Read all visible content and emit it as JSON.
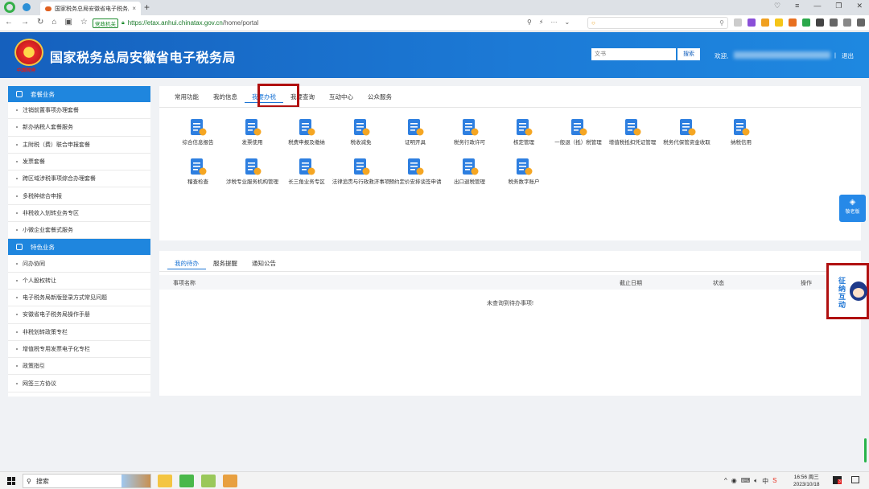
{
  "browser": {
    "tab_title": "国家税务总局安徽省电子税务局",
    "gov_badge": "党政机关",
    "url_host": "https://etax.anhui.chinatax.gov.cn",
    "url_path": "/home/portal",
    "new_tab": "+",
    "tab_close": "×"
  },
  "header": {
    "title": "国家税务总局安徽省电子税务局",
    "slogan": "中国税务",
    "search_placeholder": "文书",
    "search_button": "搜索",
    "welcome": "欢迎,",
    "separator": "|",
    "logout": "退出"
  },
  "sidebar": {
    "section1": "套餐业务",
    "items1": [
      "注销前置事项办理套餐",
      "新办纳税人套餐服务",
      "主附税（费）联合申报套餐",
      "发票套餐",
      "跨区域涉税事项综合办理套餐",
      "多税种综合申报",
      "非税收入划转业务专区",
      "小微企业套餐式服务"
    ],
    "section2": "特色业务",
    "items2": [
      "问办协同",
      "个人股权转让",
      "电子税务局新版登录方式常见问题",
      "安徽省电子税务局操作手册",
      "非税划转政策专栏",
      "增值税专用发票电子化专栏",
      "政策指引",
      "网签三方协议"
    ]
  },
  "main": {
    "tabs": [
      "常用功能",
      "我的信息",
      "我要办税",
      "我要查询",
      "互动中心",
      "公众服务"
    ],
    "active_tab": "我要办税",
    "tools": [
      {
        "label": "综合信息报告",
        "color": "#2e7fe0"
      },
      {
        "label": "发票使用",
        "color": "#2e7fe0"
      },
      {
        "label": "税费申报及缴纳",
        "color": "#2e7fe0"
      },
      {
        "label": "税收减免",
        "color": "#2e7fe0"
      },
      {
        "label": "证明开具",
        "color": "#2e7fe0"
      },
      {
        "label": "税务行政许可",
        "color": "#2e7fe0"
      },
      {
        "label": "核定管理",
        "color": "#2e7fe0"
      },
      {
        "label": "一般退（抵）税管理",
        "color": "#2e7fe0"
      },
      {
        "label": "增值税抵扣凭证管理",
        "color": "#2e7fe0"
      },
      {
        "label": "税务代保管资金收取",
        "color": "#2e7fe0"
      },
      {
        "label": "纳税信用",
        "color": "#2e7fe0"
      },
      {
        "label": "稽查检查",
        "color": "#2e7fe0"
      },
      {
        "label": "涉税专业服务机构管理",
        "color": "#2e7fe0"
      },
      {
        "label": "长三角业务专区",
        "color": "#2e7fe0"
      },
      {
        "label": "法律追责与行政救济事项",
        "color": "#2e7fe0"
      },
      {
        "label": "预约定价安排谈签申请",
        "color": "#2e7fe0"
      },
      {
        "label": "出口退税管理",
        "color": "#2e7fe0"
      },
      {
        "label": "税务数字账户",
        "color": "#2e7fe0"
      }
    ]
  },
  "todo": {
    "tabs": [
      "我的待办",
      "服务提醒",
      "通知公告"
    ],
    "active_tab": "我的待办",
    "columns": [
      "事项名称",
      "截止日期",
      "状态",
      "操作"
    ],
    "empty_text": "未查询到待办事项!"
  },
  "floats": {
    "elder_label": "敬老版",
    "robot_text": "征纳互动"
  },
  "taskbar": {
    "search_label": "搜索",
    "time": "16:56 周三",
    "date": "2023/10/18",
    "notif_count": "3"
  }
}
